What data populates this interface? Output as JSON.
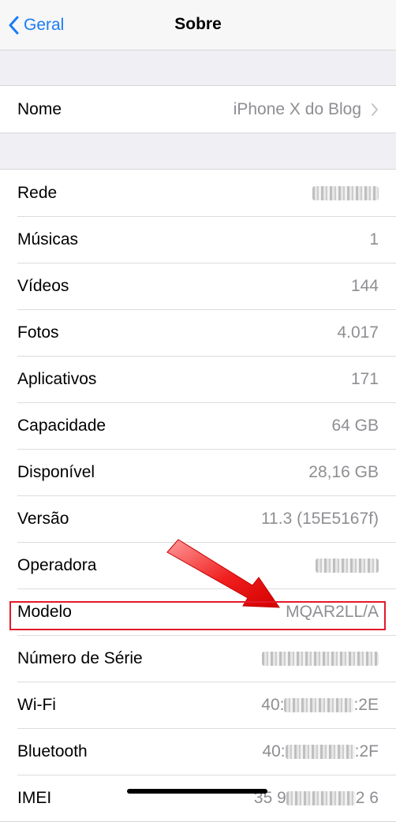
{
  "nav": {
    "back_label": "Geral",
    "title": "Sobre"
  },
  "name_row": {
    "label": "Nome",
    "value": "iPhone X do Blog"
  },
  "info": [
    {
      "label": "Rede",
      "value": ""
    },
    {
      "label": "Músicas",
      "value": "1"
    },
    {
      "label": "Vídeos",
      "value": "144"
    },
    {
      "label": "Fotos",
      "value": "4.017"
    },
    {
      "label": "Aplicativos",
      "value": "171"
    },
    {
      "label": "Capacidade",
      "value": "64 GB"
    },
    {
      "label": "Disponível",
      "value": "28,16 GB"
    },
    {
      "label": "Versão",
      "value": "11.3 (15E5167f)"
    },
    {
      "label": "Operadora",
      "value": ""
    },
    {
      "label": "Modelo",
      "value": "MQAR2LL/A"
    },
    {
      "label": "Número de Série",
      "value": ""
    },
    {
      "label": "Wi-Fi",
      "value_start": "40:",
      "value_end": ":2E"
    },
    {
      "label": "Bluetooth",
      "value_start": "40:",
      "value_end": ":2F"
    },
    {
      "label": "IMEI",
      "value_start": "35 9",
      "value_end": "2 6"
    }
  ],
  "colors": {
    "accent": "#1a7cf7",
    "highlight": "#e3192a",
    "value_gray": "#8e8e93"
  }
}
